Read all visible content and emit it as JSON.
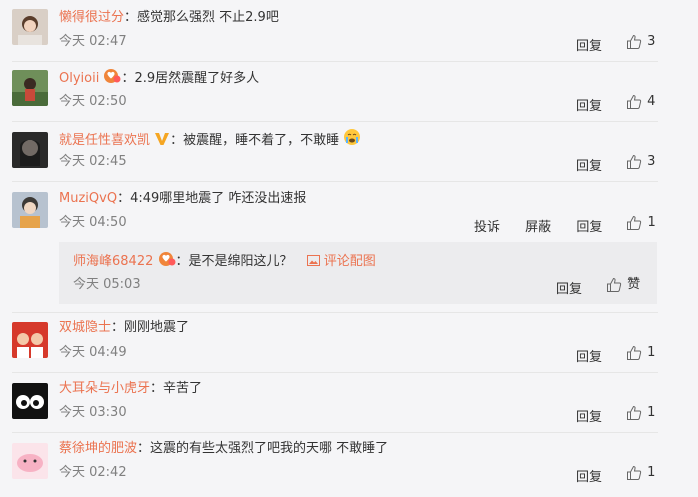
{
  "labels": {
    "reply": "回复",
    "report": "投诉",
    "block": "屏蔽",
    "like_text": "赞",
    "image_comment": "评论配图"
  },
  "comments": [
    {
      "user": "懒得很过分",
      "text": "：感觉那么强烈 不止2.9吧",
      "time": "今天 02:47",
      "likes": "3"
    },
    {
      "user": "Olyioii",
      "text": "：2.9居然震醒了好多人",
      "time": "今天 02:50",
      "likes": "4"
    },
    {
      "user": "就是任性喜欢凯",
      "text": "：被震醒，睡不着了，不敢睡",
      "time": "今天 02:45",
      "likes": "3"
    },
    {
      "user": "MuziQvQ",
      "text": "：4:49哪里地震了 咋还没出速报",
      "time": "今天 04:50",
      "likes": "1"
    },
    {
      "user": "双城隐士",
      "text": "：刚刚地震了",
      "time": "今天 04:49",
      "likes": "1"
    },
    {
      "user": "大耳朵与小虎牙",
      "text": "：辛苦了",
      "time": "今天 03:30",
      "likes": "1"
    },
    {
      "user": "蔡徐坤的肥波",
      "text": "：这震的有些太强烈了吧我的天哪 不敢睡了",
      "time": "今天 02:42",
      "likes": "1"
    }
  ],
  "reply": {
    "user": "师海峰68422",
    "text": "：是不是绵阳这儿？",
    "time": "今天 05:03"
  },
  "colors": {
    "username": "#eb7350",
    "time": "#808080",
    "background": "#f5f5f7",
    "reply_bg": "#ececee"
  }
}
